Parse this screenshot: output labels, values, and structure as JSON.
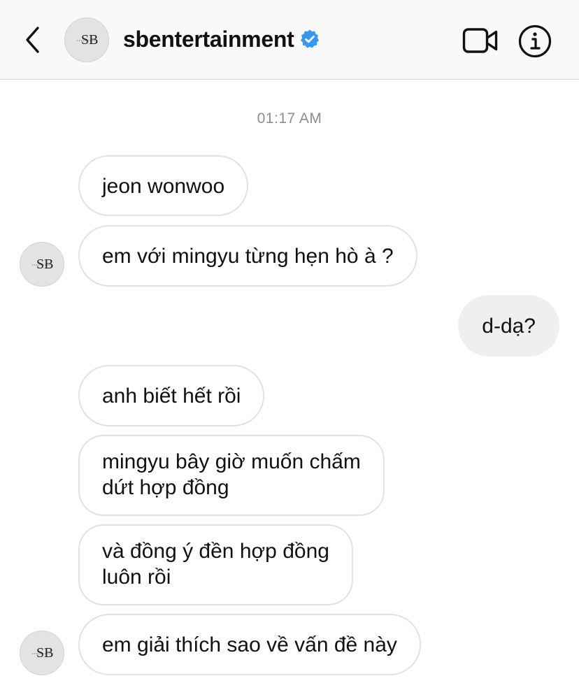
{
  "header": {
    "back_icon": "chevron-left-icon",
    "avatar_initials": "SB",
    "title": "sbentertainment",
    "verified_icon": "verified-badge-icon",
    "verified_color": "#3897f0",
    "video_icon": "video-camera-icon",
    "info_icon": "info-icon"
  },
  "thread": {
    "timestamp": "01:17 AM",
    "messages": [
      {
        "direction": "incoming",
        "text": "jeon wonwoo"
      },
      {
        "direction": "incoming",
        "text": "em với mingyu từng hẹn hò à ?"
      },
      {
        "direction": "outgoing",
        "text": "d-dạ?"
      },
      {
        "direction": "incoming",
        "text": "anh biết hết rồi"
      },
      {
        "direction": "incoming",
        "lines": [
          "mingyu bây giờ muốn chấm",
          "dứt hợp đồng"
        ]
      },
      {
        "direction": "incoming",
        "lines": [
          "và đồng ý đền hợp đồng",
          "luôn rồi"
        ]
      },
      {
        "direction": "incoming",
        "text": "em giải thích sao về vấn đề này"
      }
    ]
  },
  "colors": {
    "header_bg": "#f9f9f9",
    "incoming_border": "#e2e2e2",
    "outgoing_bg": "#efefef",
    "timestamp": "#8e8e8e"
  }
}
